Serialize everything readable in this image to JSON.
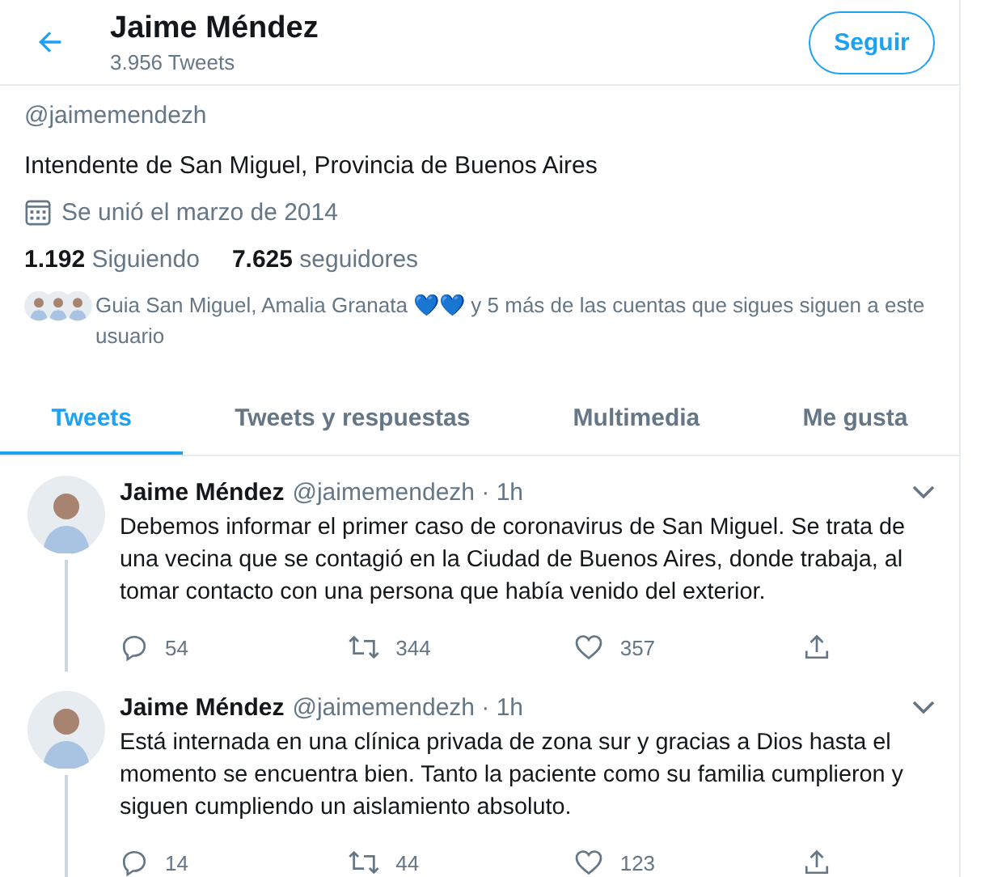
{
  "header": {
    "name": "Jaime Méndez",
    "tweet_count": "3.956 Tweets",
    "follow_button": "Seguir"
  },
  "profile": {
    "handle": "@jaimemendezh",
    "bio": "Intendente de San Miguel, Provincia de Buenos Aires",
    "joined": "Se unió el marzo de 2014",
    "following": {
      "count": "1.192",
      "label": "Siguiendo"
    },
    "followers": {
      "count": "7.625",
      "label": "seguidores"
    },
    "followed_by": "Guia San Miguel, Amalia Granata 💙💙 y 5 más de las cuentas que sigues siguen a este usuario"
  },
  "tabs": [
    {
      "label": "Tweets",
      "selected": true
    },
    {
      "label": "Tweets y respuestas",
      "selected": false
    },
    {
      "label": "Multimedia",
      "selected": false
    },
    {
      "label": "Me gusta",
      "selected": false
    }
  ],
  "tweets": [
    {
      "name": "Jaime Méndez",
      "handle_time": "@jaimemendezh · 1h",
      "text": "Debemos informar el primer caso de coronavirus de San Miguel. Se trata de una vecina que se contagió en la Ciudad de Buenos Aires, donde trabaja, al tomar contacto con una persona que había venido del exterior.",
      "replies": "54",
      "retweets": "344",
      "likes": "357",
      "thread": true
    },
    {
      "name": "Jaime Méndez",
      "handle_time": "@jaimemendezh · 1h",
      "text": "Está internada en una clínica privada de zona sur y gracias a Dios hasta el momento se encuentra bien. Tanto la paciente como su familia cumplieron y siguen cumpliendo un aislamiento absoluto.",
      "replies": "14",
      "retweets": "44",
      "likes": "123",
      "thread": true
    }
  ]
}
